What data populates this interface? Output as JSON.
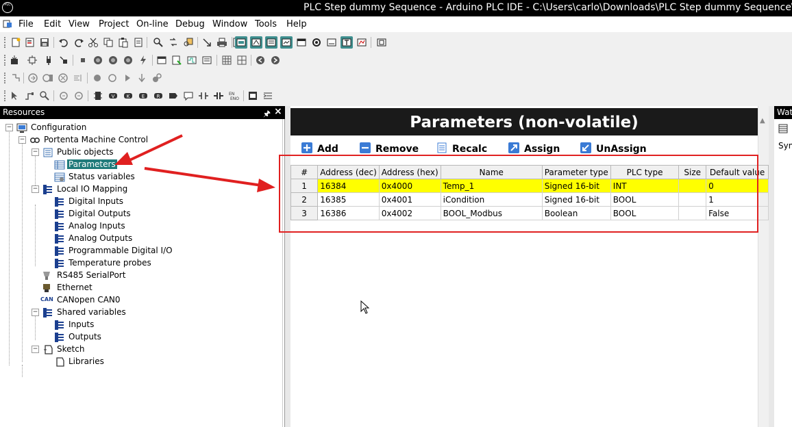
{
  "window": {
    "title": "PLC Step dummy Sequence - Arduino PLC IDE - C:\\Users\\carlo\\Downloads\\PLC Step dummy Sequence\\PLC St",
    "app_icon_text": "PLC"
  },
  "menu": [
    "File",
    "Edit",
    "View",
    "Project",
    "On-line",
    "Debug",
    "Window",
    "Tools",
    "Help"
  ],
  "resources": {
    "title": "Resources",
    "tree": [
      {
        "label": "Configuration"
      },
      {
        "label": "Portenta Machine Control"
      },
      {
        "label": "Public objects"
      },
      {
        "label": "Parameters"
      },
      {
        "label": "Status variables"
      },
      {
        "label": "Local IO Mapping"
      },
      {
        "label": "Digital Inputs"
      },
      {
        "label": "Digital Outputs"
      },
      {
        "label": "Analog Inputs"
      },
      {
        "label": "Analog Outputs"
      },
      {
        "label": "Programmable Digital I/O"
      },
      {
        "label": "Temperature probes"
      },
      {
        "label": "RS485 SerialPort"
      },
      {
        "label": "Ethernet"
      },
      {
        "label": "CANopen CAN0",
        "badge": "CAN"
      },
      {
        "label": "Shared variables"
      },
      {
        "label": "Inputs"
      },
      {
        "label": "Outputs"
      },
      {
        "label": "Sketch"
      },
      {
        "label": "Libraries"
      }
    ]
  },
  "editor": {
    "title": "Parameters (non-volatile)",
    "actions": {
      "add": "Add",
      "remove": "Remove",
      "recalc": "Recalc",
      "assign": "Assign",
      "unassign": "UnAssign"
    },
    "columns": [
      "#",
      "Address (dec)",
      "Address (hex)",
      "Name",
      "Parameter type",
      "PLC type",
      "Size",
      "Default value"
    ],
    "rows": [
      {
        "n": "1",
        "dec": "16384",
        "hex": "0x4000",
        "name": "Temp_1",
        "ptype": "Signed 16-bit",
        "plc": "INT",
        "size": "",
        "def": "0"
      },
      {
        "n": "2",
        "dec": "16385",
        "hex": "0x4001",
        "name": "iCondition",
        "ptype": "Signed 16-bit",
        "plc": "BOOL",
        "size": "",
        "def": "1"
      },
      {
        "n": "3",
        "dec": "16386",
        "hex": "0x4002",
        "name": "BOOL_Modbus",
        "ptype": "Boolean",
        "plc": "BOOL",
        "size": "",
        "def": "False"
      }
    ]
  },
  "watch": {
    "title": "Wat",
    "sym": "Sym"
  },
  "colors": {
    "selection": "#1f7a7a",
    "highlight_row": "#ffff00",
    "annotation_red": "#e02020",
    "header_black": "#000000"
  }
}
